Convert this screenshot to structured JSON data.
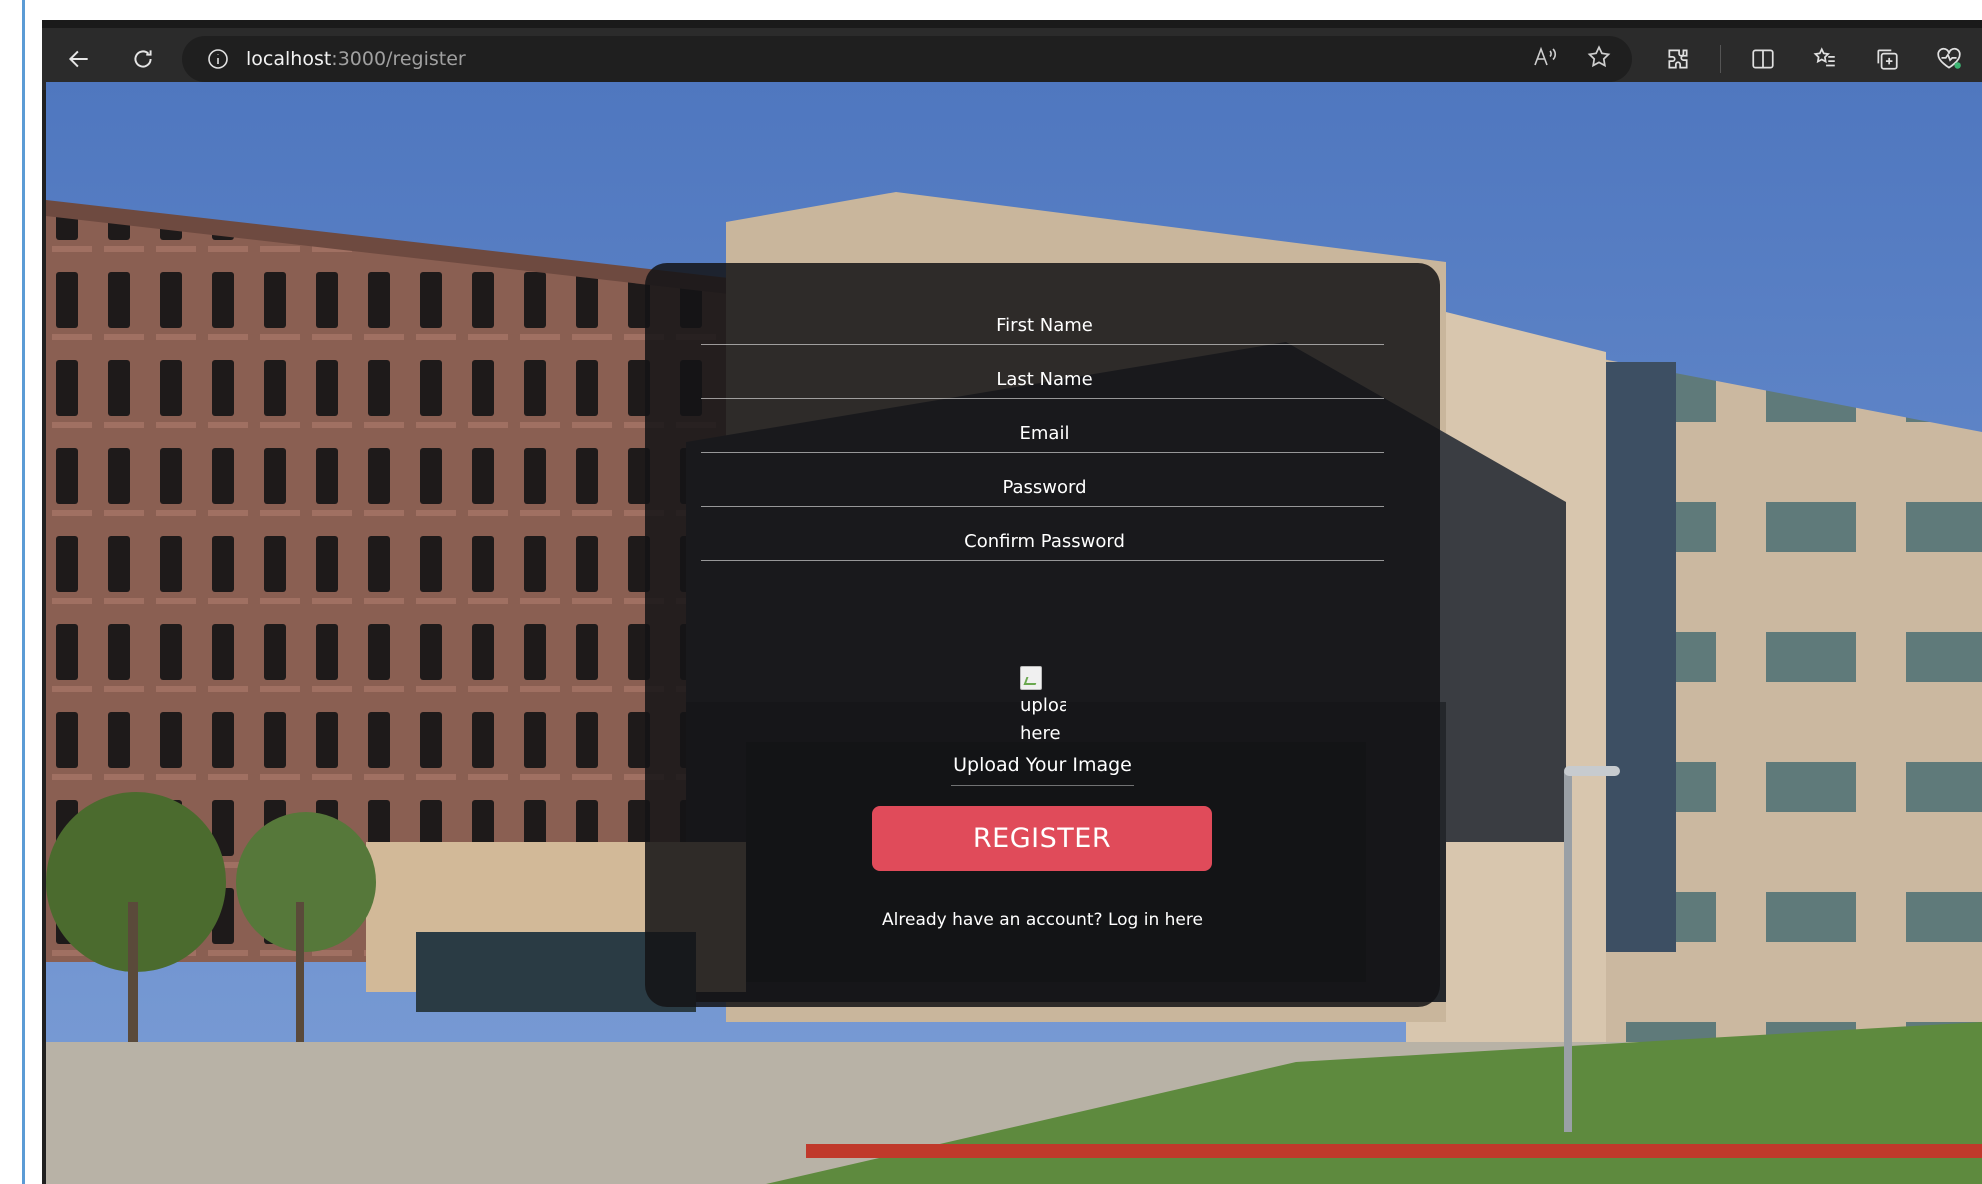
{
  "browser": {
    "url_host": "localhost",
    "url_path": ":3000/register"
  },
  "form": {
    "first_name_placeholder": "First Name",
    "last_name_placeholder": "Last Name",
    "email_placeholder": "Email",
    "password_placeholder": "Password",
    "confirm_password_placeholder": "Confirm Password",
    "image_alt": "upload here",
    "upload_label": "Upload Your Image",
    "register_label": "REGISTER",
    "login_link": "Already have an account? Log in here"
  },
  "colors": {
    "accent": "#e04b5a",
    "card_bg": "rgba(20,20,22,0.86)"
  },
  "icons": [
    "back-arrow-icon",
    "refresh-icon",
    "info-icon",
    "read-aloud-icon",
    "favorite-star-icon",
    "extensions-icon",
    "split-screen-icon",
    "favorites-list-icon",
    "collections-icon",
    "browser-essentials-icon",
    "broken-image-icon"
  ]
}
